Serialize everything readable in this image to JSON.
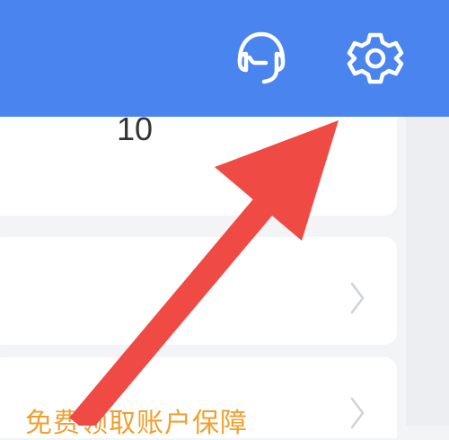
{
  "header": {
    "background_color": "#4a84ee",
    "icons": [
      {
        "name": "customer-service-headset-icon"
      },
      {
        "name": "gear-icon"
      }
    ]
  },
  "summary": {
    "count_value": "10"
  },
  "list": {
    "promo_text": "免费领取账户保障"
  },
  "annotation": {
    "arrow_color": "#f04a44",
    "target": "gear-icon"
  }
}
